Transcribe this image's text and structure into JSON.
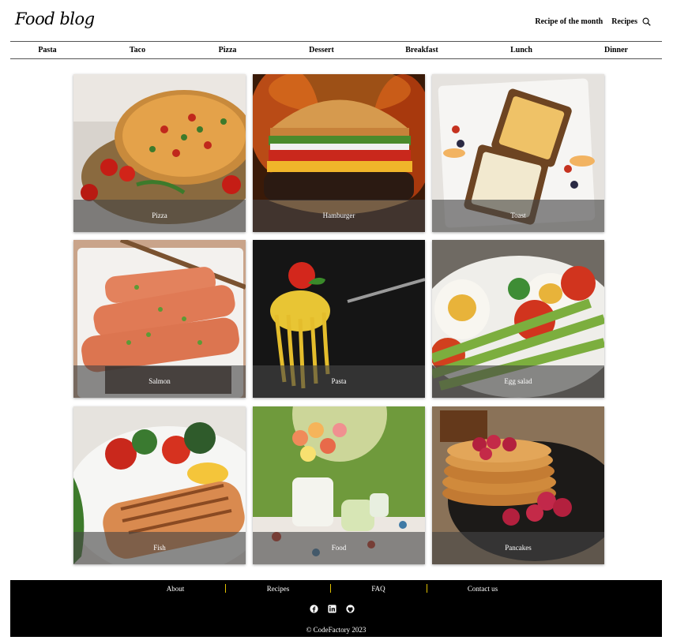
{
  "header": {
    "logo": "Food blog",
    "links": [
      "Recipe of the month",
      "Recipes"
    ]
  },
  "categories": [
    "Pasta",
    "Taco",
    "Pizza",
    "Dessert",
    "Breakfast",
    "Lunch",
    "Dinner"
  ],
  "cards": [
    "Pizza",
    "Hamburger",
    "Toast",
    "Salmon",
    "Pasta",
    "Egg salad",
    "Fish",
    "Food",
    "Pancakes"
  ],
  "footer": {
    "links": [
      "About",
      "Recipes",
      "FAQ",
      "Contact us"
    ],
    "social_icons": [
      "facebook-icon",
      "linkedin-icon",
      "github-icon"
    ],
    "copyright": "© CodeFactory 2023"
  },
  "colors": {
    "footer_bg": "#000000",
    "separator": "#e0c000",
    "caption_overlay": "rgba(70,70,70,0.62)"
  }
}
